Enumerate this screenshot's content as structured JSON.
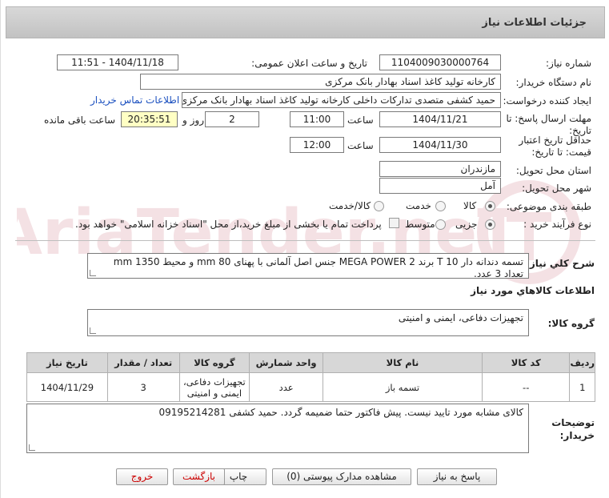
{
  "header": {
    "title": "جزئیات اطلاعات نیاز"
  },
  "form": {
    "need_number": {
      "label": "شماره نیاز:",
      "value": "1104009030000764"
    },
    "announce_datetime": {
      "label": "تاریخ و ساعت اعلان عمومی:",
      "value": "1404/11/18 - 11:51"
    },
    "buyer_org": {
      "label": "نام دستگاه خریدار:",
      "value": "کارخانه تولید کاغذ اسناد بهادار بانک مرکزی"
    },
    "requester": {
      "label": "ایجاد کننده درخواست:",
      "value": "حمید کشفی متصدی تدارکات داخلی کارخانه تولید کاغذ اسناد بهادار بانک مرکزی",
      "contact_link": "اطلاعات تماس خریدار"
    },
    "reply_deadline": {
      "label_line1": "مهلت ارسال پاسخ: تا",
      "label_line2": "تاریخ:",
      "date": "1404/11/21",
      "time_label": "ساعت",
      "time": "11:00",
      "days": "2",
      "days_label": "روز و",
      "remaining": "20:35:51",
      "remaining_label": "ساعت باقی مانده"
    },
    "price_validity": {
      "label_line1": "حداقل تاریخ اعتبار",
      "label_line2": "قیمت: تا تاریخ:",
      "date": "1404/11/30",
      "time_label": "ساعت",
      "time": "12:00"
    },
    "province": {
      "label": "استان محل تحویل:",
      "value": "مازندران"
    },
    "city": {
      "label": "شهر محل تحویل:",
      "value": "آمل"
    },
    "category": {
      "label": "طبقه بندی موضوعی:",
      "options": [
        "کالا",
        "خدمت",
        "کالا/خدمت"
      ],
      "selected": "کالا"
    },
    "purchase_process": {
      "label": "نوع فرآیند خرید :",
      "options": [
        "جزیی",
        "متوسط"
      ],
      "selected": "جزیی",
      "treasury_text": "پرداخت تمام یا بخشی از مبلغ خرید،از محل \"اسناد خزانه اسلامی\" خواهد بود."
    }
  },
  "description": {
    "label": "شرح کلي نياز:",
    "text": "تسمه دندانه دار T 10 برند MEGA POWER 2  جنس اصل آلمانی با پهنای mm 80 و محیط  mm 1350 تعداد 3 عدد."
  },
  "goods_section": {
    "title": "اطلاعات کالاهاي مورد نياز",
    "group_label": "گروه کالا:",
    "group_value": "تجهیزات دفاعی، ایمنی و امنیتی"
  },
  "table": {
    "headers": [
      "ردیف",
      "کد کالا",
      "نام کالا",
      "واحد شمارش",
      "تعداد / مقدار",
      "تاریخ نیاز"
    ],
    "rows": [
      {
        "row": "1",
        "code": "--",
        "name": "تسمه باز",
        "unit": "عدد",
        "qty": "3",
        "date": "1404/11/29",
        "group_line1": "تجهیزات دفاعی،",
        "group_line2": "ایمنی و امنیتی"
      }
    ],
    "group_header": "گروه کالا"
  },
  "buyer_notes": {
    "label_line1": "توضیحات",
    "label_line2": "خریدار:",
    "text": "کالای مشابه مورد تایید نیست. پیش فاکتور حتما ضمیمه گردد. حمید کشفی 09195214281"
  },
  "buttons": {
    "reply": "پاسخ به نیاز",
    "attachments": "مشاهده مدارک پیوستی (0)",
    "print": "چاپ",
    "back": "بازگشت",
    "exit": "خروج"
  },
  "watermark": {
    "text": "AriaTender.neT"
  },
  "colors": {
    "header_bg": "#c8c8c8",
    "link": "#1a4fbf",
    "highlight": "#ffffc4",
    "danger": "#cc0000"
  }
}
